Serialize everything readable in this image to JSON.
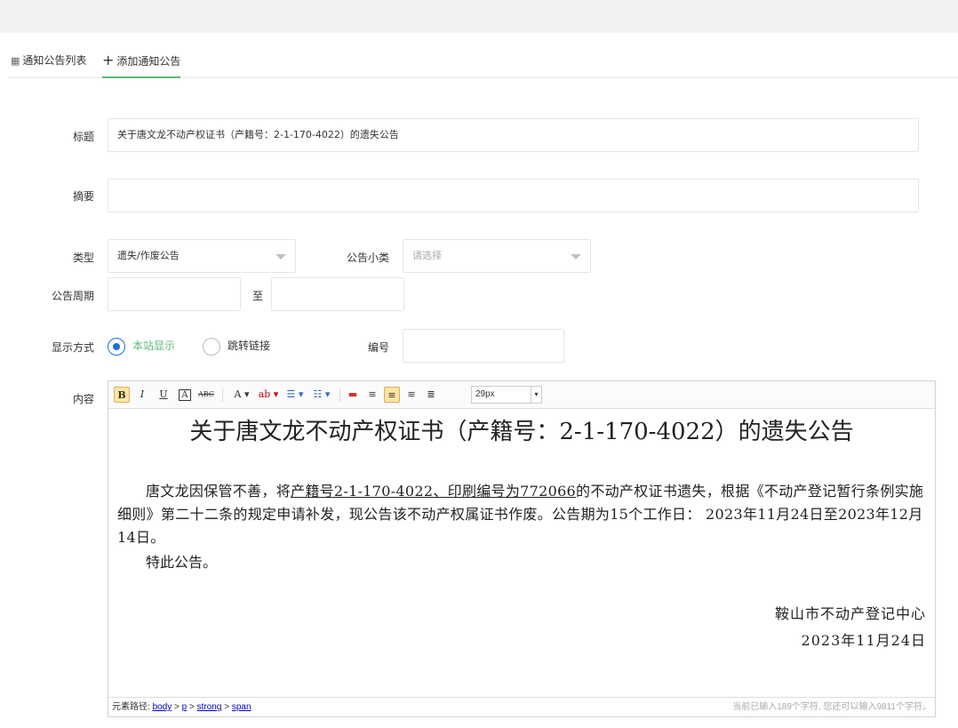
{
  "tabs": {
    "list_label": "通知公告列表",
    "add_label": "添加通知公告"
  },
  "form": {
    "title_label": "标题",
    "title_value": "关于唐文龙不动产权证书（产籍号：2-1-170-4022）的遗失公告",
    "summary_label": "摘要",
    "summary_value": "",
    "type_label": "类型",
    "type_value": "遗失/作废公告",
    "subtype_label": "公告小类",
    "subtype_placeholder": "请选择",
    "period_label": "公告周期",
    "period_sep": "至",
    "display_label": "显示方式",
    "display_options": [
      "本站显示",
      "跳转链接"
    ],
    "display_selected": "本站显示",
    "number_label": "编号",
    "content_label": "内容"
  },
  "editor": {
    "font_size": "29px",
    "doc_title": "关于唐文龙不动产权证书（产籍号：2-1-170-4022）的遗失公告",
    "para_start": "唐文龙因保管不善，将",
    "para_underline": "产籍号2-1-170-4022、印刷编号为772066",
    "para_end": "的不动产权证书遗失，根据《不动产登记暂行条例实施细则》第二十二条的规定申请补发，现公告该不动产权属证书作废。公告期为15个工作日： 2023年11月24日至2023年12月14日。",
    "para2": "特此公告。",
    "sign_org": "鞍山市不动产登记中心",
    "sign_date": "2023年11月24日",
    "path_label": "元素路径:",
    "path_items": [
      "body",
      "p",
      "strong",
      "span"
    ],
    "char_count": "当前已输入189个字符, 您还可以输入9811个字符。"
  },
  "colors": {
    "accent_green": "#5fb878",
    "radio_blue": "#1e6fd9",
    "active_button": "#ffe69f"
  }
}
